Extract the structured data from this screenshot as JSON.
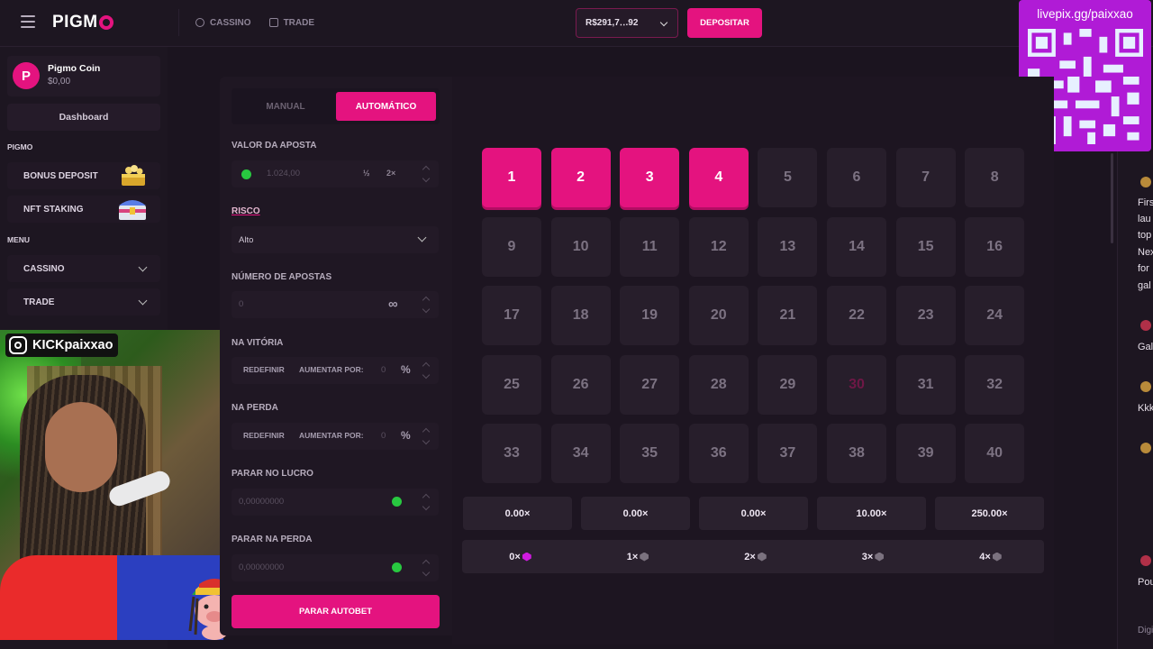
{
  "header": {
    "logo": "PIGM",
    "nav": [
      {
        "label": "CASSINO",
        "icon": "casino-chip-icon"
      },
      {
        "label": "TRADE",
        "icon": "trade-chart-icon"
      }
    ],
    "balance": "R$291,7‥.92",
    "deposit_label": "DEPOSITAR"
  },
  "overlay": {
    "qr_text": "livepix.gg/paixxao",
    "instagram_handle": "KICKpaixxao"
  },
  "sidebar": {
    "coin_name": "Pigmo Coin",
    "coin_value": "$0,00",
    "coin_initial": "P",
    "dashboard_label": "Dashboard",
    "section_pigmo": "PIGMO",
    "bonus_deposit": "BONUS DEPOSIT",
    "nft_staking": "NFT STAKING",
    "section_menu": "MENU",
    "cassino": "CASSINO",
    "trade": "TRADE"
  },
  "bet_panel": {
    "tab_manual": "MANUAL",
    "tab_auto": "AUTOMÁTICO",
    "bet_value_label": "VALOR DA APOSTA",
    "bet_value": "1.024,00",
    "half_label": "½",
    "double_label": "2×",
    "risk_label": "RISCO",
    "risk_value": "Alto",
    "num_bets_label": "NÚMERO DE APOSTAS",
    "num_bets_value": "0",
    "infinity_symbol": "∞",
    "on_win_label": "NA VITÓRIA",
    "on_loss_label": "NA PERDA",
    "reset_label": "REDEFINIR",
    "increase_label": "AUMENTAR POR:",
    "increase_value": "0",
    "percent_symbol": "%",
    "stop_profit_label": "PARAR NO LUCRO",
    "stop_profit_value": "0,00000000",
    "stop_loss_label": "PARAR NA PERDA",
    "stop_loss_value": "0,00000000",
    "stop_autobet_label": "PARAR AUTOBET"
  },
  "keno": {
    "tiles": [
      "1",
      "2",
      "3",
      "4",
      "5",
      "6",
      "7",
      "8",
      "9",
      "10",
      "11",
      "12",
      "13",
      "14",
      "15",
      "16",
      "17",
      "18",
      "19",
      "20",
      "21",
      "22",
      "23",
      "24",
      "25",
      "26",
      "27",
      "28",
      "29",
      "30",
      "31",
      "32",
      "33",
      "34",
      "35",
      "36",
      "37",
      "38",
      "39",
      "40"
    ],
    "selected": [
      1,
      2,
      3,
      4
    ],
    "drawn": [
      30
    ],
    "payouts": [
      "0.00×",
      "0.00×",
      "0.00×",
      "10.00×",
      "250.00×"
    ],
    "hits": [
      "0×",
      "1×",
      "2×",
      "3×",
      "4×"
    ]
  },
  "chat": {
    "lines": [
      "Firs",
      "lau",
      "top",
      "Nex",
      "for",
      "gal",
      "Gal",
      "Kkk",
      "Pou",
      "Digi"
    ]
  },
  "colors": {
    "accent": "#e4137f",
    "background": "#1b141f",
    "qr_bg": "#b01bd6"
  }
}
